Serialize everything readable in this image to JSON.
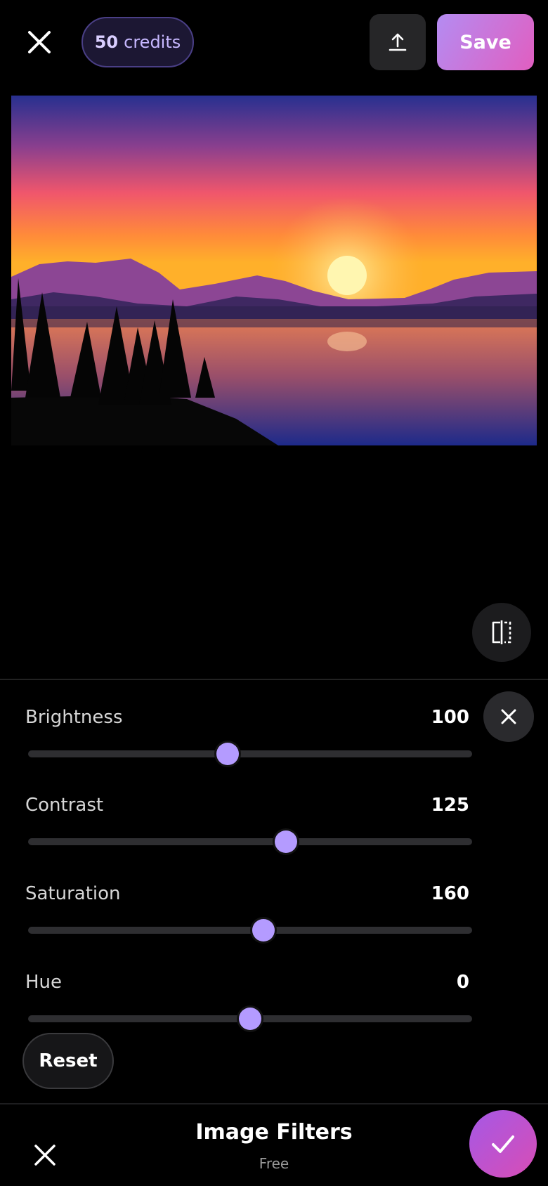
{
  "header": {
    "credits_number": "50",
    "credits_label": "credits",
    "save_label": "Save",
    "icons": [
      "close-icon",
      "upload-icon"
    ]
  },
  "filters": {
    "brightness": {
      "label": "Brightness",
      "value": "100",
      "position": 0.45
    },
    "contrast": {
      "label": "Contrast",
      "value": "125",
      "position": 0.58
    },
    "saturation": {
      "label": "Saturation",
      "value": "160",
      "position": 0.53
    },
    "hue": {
      "label": "Hue",
      "value": "0",
      "position": 0.5
    }
  },
  "reset_label": "Reset",
  "footer": {
    "title": "Image Filters",
    "subtitle": "Free"
  },
  "colors": {
    "accent": "#b49bff",
    "save_gradient_start": "#b48cf2",
    "save_gradient_end": "#e15ec0"
  }
}
